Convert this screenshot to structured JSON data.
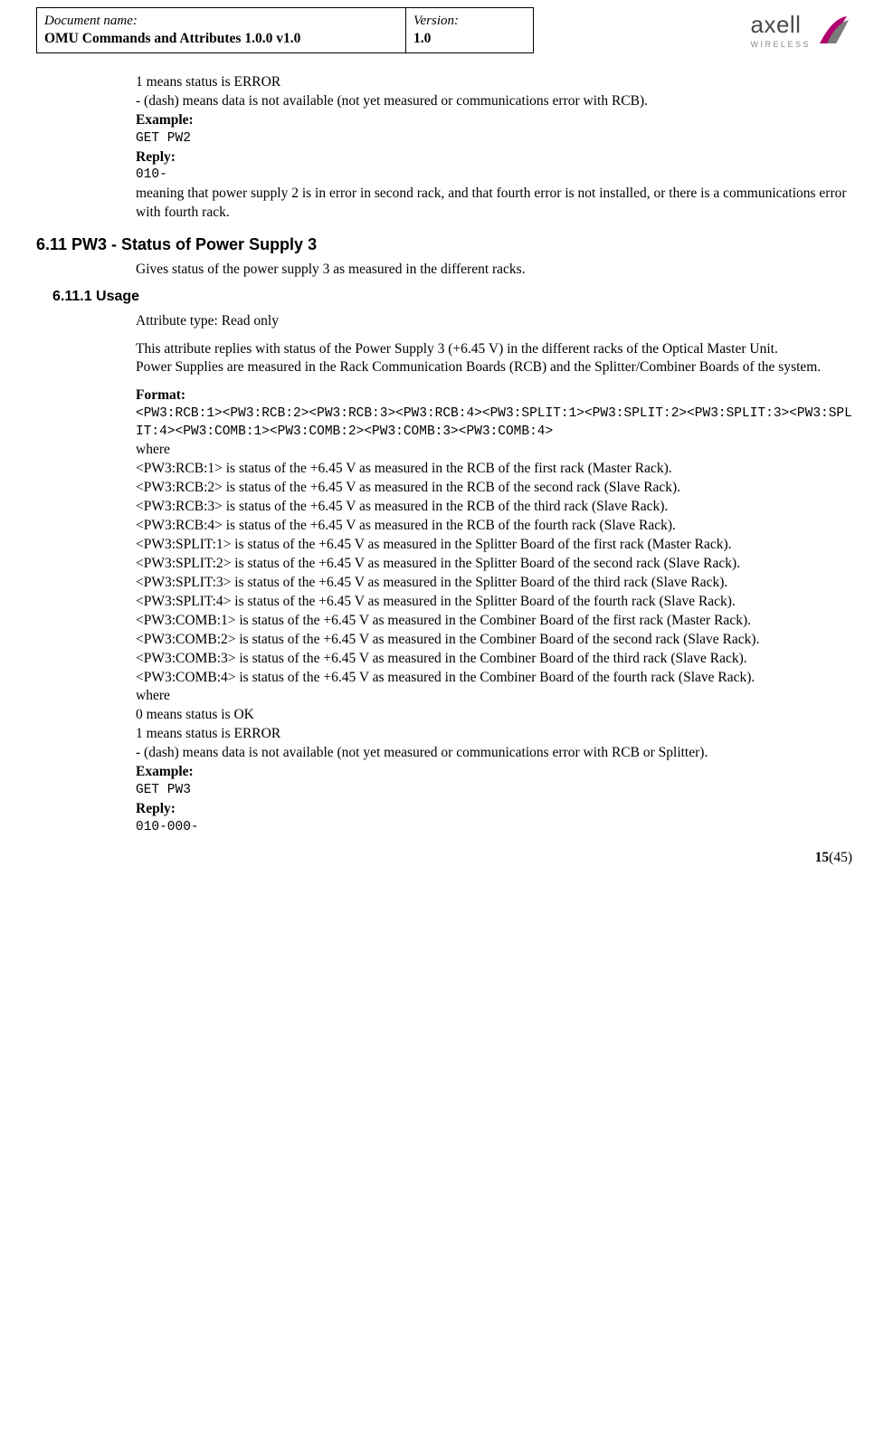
{
  "header": {
    "doc_label": "Document name:",
    "doc_value": "OMU Commands and Attributes 1.0.0 v1.0",
    "ver_label": "Version:",
    "ver_value": "1.0"
  },
  "logo": {
    "brand": "axell",
    "sub": "WIRELESS"
  },
  "intro": {
    "l1": "1 means status is ERROR",
    "l2": "- (dash) means data is not available (not yet measured or communications error with RCB).",
    "example_label": "Example:",
    "example_cmd": "GET PW2",
    "reply_label": "Reply:",
    "reply_val": "010-",
    "meaning": "meaning that power supply 2 is in error in second rack, and that fourth error is not installed, or there is a communications error with fourth rack."
  },
  "sec611": {
    "heading": "6.11  PW3 - Status of Power Supply 3",
    "desc": "Gives status of the power supply 3 as measured in the different racks."
  },
  "sec6111": {
    "heading": "6.11.1  Usage",
    "attr_type": "Attribute type: Read only",
    "p1": "This attribute replies with status of the Power Supply 3 (+6.45 V) in the different racks of the Optical Master Unit.",
    "p2": "Power Supplies are measured in the Rack Communication Boards (RCB) and the Splitter/Combiner Boards of the system.",
    "format_label": "Format:",
    "format_line": "<PW3:RCB:1><PW3:RCB:2><PW3:RCB:3><PW3:RCB:4><PW3:SPLIT:1><PW3:SPLIT:2><PW3:SPLIT:3><PW3:SPLIT:4><PW3:COMB:1><PW3:COMB:2><PW3:COMB:3><PW3:COMB:4>",
    "where1": "where",
    "rcb1": "<PW3:RCB:1> is status of the +6.45 V as measured in the RCB of the first rack (Master Rack).",
    "rcb2": "<PW3:RCB:2> is status of the +6.45 V as measured in the RCB of the second rack (Slave Rack).",
    "rcb3": "<PW3:RCB:3> is status of the +6.45 V as measured in the RCB of the third rack (Slave Rack).",
    "rcb4": "<PW3:RCB:4> is status of the +6.45 V as measured in the RCB of the fourth rack (Slave Rack).",
    "split1": "<PW3:SPLIT:1> is status of the +6.45 V as measured in the Splitter Board of the first rack (Master Rack).",
    "split2": "<PW3:SPLIT:2> is status of the +6.45 V as measured in the Splitter Board of the second rack (Slave Rack).",
    "split3": "<PW3:SPLIT:3> is status of the +6.45 V as measured in the Splitter Board of the third rack (Slave Rack).",
    "split4": "<PW3:SPLIT:4> is status of the +6.45 V as measured in the Splitter Board of the fourth rack (Slave Rack).",
    "comb1": "<PW3:COMB:1> is status of the +6.45 V as measured in the Combiner Board of the first rack (Master Rack).",
    "comb2": "<PW3:COMB:2> is status of the +6.45 V as measured in the Combiner Board of the second rack (Slave Rack).",
    "comb3": "<PW3:COMB:3> is status of the +6.45 V as measured in the Combiner Board of the third rack (Slave Rack).",
    "comb4": "<PW3:COMB:4> is status of the +6.45 V as measured in the Combiner Board of the fourth rack (Slave Rack).",
    "where2": "where",
    "status0": "0 means status is OK",
    "status1": "1 means status is ERROR",
    "statusdash": "- (dash) means data is not available (not yet measured or communications error with RCB or Splitter).",
    "example_label": "Example:",
    "example_cmd": "GET PW3",
    "reply_label": "Reply:",
    "reply_val": "010-000-"
  },
  "footer": {
    "page_current": "15",
    "page_total": "(45)"
  }
}
